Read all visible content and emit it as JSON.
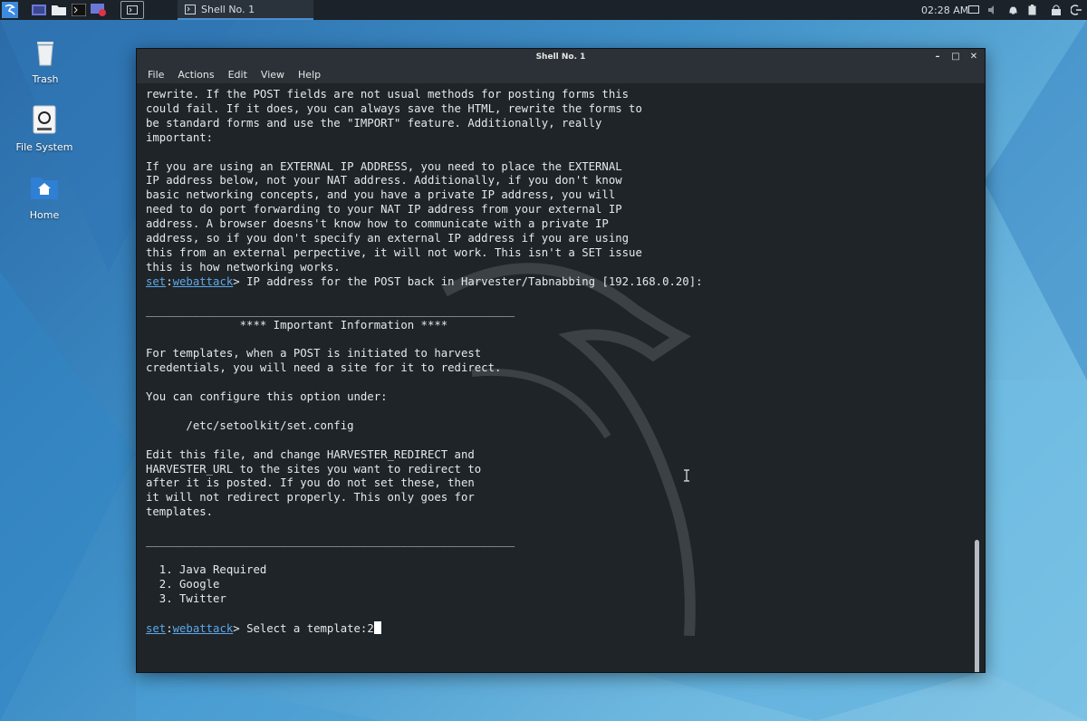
{
  "colors": {
    "accent": "#4b8fd0",
    "prompt_link": "#5fa8e8",
    "terminal_bg": "#1e2428"
  },
  "panel": {
    "task_title": "Shell No. 1",
    "clock": "02:28 AM",
    "launchers": [
      "kali-menu-icon",
      "desktop-icon",
      "file-manager-icon",
      "terminal-icon",
      "screen-recorder-icon"
    ],
    "tray_icons": [
      "display-icon",
      "volume-icon",
      "notification-icon",
      "battery-icon",
      "lock-icon",
      "logout-icon"
    ]
  },
  "desktop": {
    "icons": [
      {
        "label": "Trash",
        "icon": "trash-icon"
      },
      {
        "label": "File System",
        "icon": "drive-icon"
      },
      {
        "label": "Home",
        "icon": "home-folder-icon"
      }
    ]
  },
  "window": {
    "title": "Shell No. 1",
    "menu": [
      "File",
      "Actions",
      "Edit",
      "View",
      "Help"
    ]
  },
  "terminal": {
    "block1": "rewrite. If the POST fields are not usual methods for posting forms this\ncould fail. If it does, you can always save the HTML, rewrite the forms to\nbe standard forms and use the \"IMPORT\" feature. Additionally, really\nimportant:\n\nIf you are using an EXTERNAL IP ADDRESS, you need to place the EXTERNAL\nIP address below, not your NAT address. Additionally, if you don't know\nbasic networking concepts, and you have a private IP address, you will\nneed to do port forwarding to your NAT IP address from your external IP\naddress. A browser doesns't know how to communicate with a private IP\naddress, so if you don't specify an external IP address if you are using\nthis from an external perpective, it will not work. This isn't a SET issue\nthis is how networking works.\n",
    "prompt_set": "set",
    "prompt_colon": ":",
    "prompt_module": "webattack",
    "prompt1_text": "> IP address for the POST back in Harvester/Tabnabbing [192.168.0.20]:",
    "block2": "\n_______________________________________________________\n              **** Important Information ****\n\nFor templates, when a POST is initiated to harvest\ncredentials, you will need a site for it to redirect.\n\nYou can configure this option under:\n\n      /etc/setoolkit/set.config\n\nEdit this file, and change HARVESTER_REDIRECT and\nHARVESTER_URL to the sites you want to redirect to\nafter it is posted. If you do not set these, then\nit will not redirect properly. This only goes for\ntemplates.\n\n_______________________________________________________\n\n  1. Java Required\n  2. Google\n  3. Twitter\n\n",
    "prompt2_text": "> Select a template:",
    "input_value": "2"
  }
}
